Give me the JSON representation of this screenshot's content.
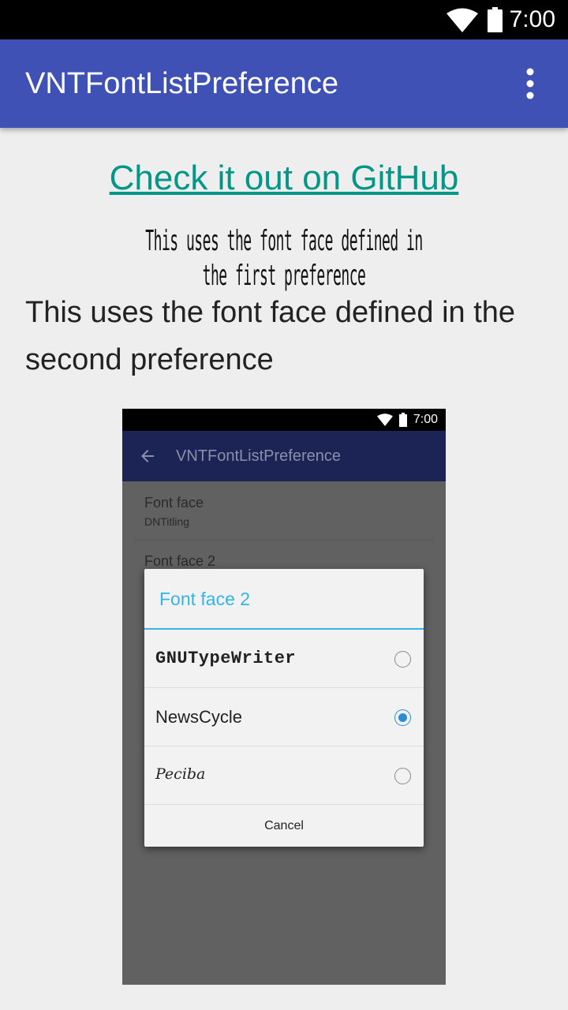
{
  "status_bar": {
    "time": "7:00",
    "wifi_icon": "wifi-icon",
    "battery_icon": "battery-icon"
  },
  "app_bar": {
    "title": "VNTFontListPreference",
    "overflow_icon": "more-vert-icon",
    "color": "#3f51b5"
  },
  "main": {
    "github_link": "Check it out on GitHub",
    "first_pref_text": "This uses the font face defined in the first preference",
    "second_pref_text": "This uses the font face defined in the second preference",
    "link_color": "#009688"
  },
  "embedded_screenshot": {
    "status_time": "7:00",
    "app_title": "VNTFontListPreference",
    "back_icon": "arrow-back-icon",
    "pref1": {
      "title": "Font face",
      "summary": "DNTitling"
    },
    "pref2": {
      "title": "Font face 2"
    },
    "dialog": {
      "title": "Font face 2",
      "options": [
        {
          "label": "GNUTypeWriter",
          "selected": false
        },
        {
          "label": "NewsCycle",
          "selected": true
        },
        {
          "label": "Peciba",
          "selected": false
        }
      ],
      "cancel_label": "Cancel",
      "accent_color": "#33b5e5"
    }
  }
}
